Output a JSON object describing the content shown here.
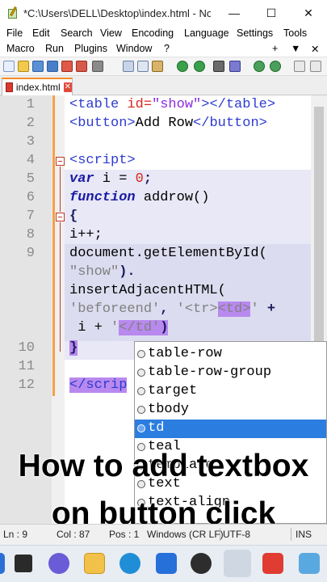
{
  "window": {
    "title": "*C:\\Users\\DELL\\Desktop\\index.html - Note...",
    "minimize_glyph": "—",
    "maximize_glyph": "☐",
    "close_glyph": "✕"
  },
  "menu": {
    "row1": [
      "File",
      "Edit",
      "Search",
      "View",
      "Encoding",
      "Language",
      "Settings",
      "Tools"
    ],
    "row2": [
      "Macro",
      "Run",
      "Plugins",
      "Window",
      "?"
    ],
    "right_controls": [
      "+",
      "▼",
      "✕"
    ]
  },
  "tab": {
    "name": "index.html",
    "close_glyph": "✕"
  },
  "editor": {
    "line_numbers": [
      "1",
      "2",
      "3",
      "4",
      "5",
      "6",
      "7",
      "8",
      "9",
      "10",
      "11",
      "12"
    ],
    "line1": {
      "open": "<table ",
      "attr": "id=",
      "value": "\"show\"",
      "close": "></table>"
    },
    "line2": {
      "open": "<button>",
      "text": "Add Row",
      "close": "</button>"
    },
    "line4": {
      "tag": "<script>"
    },
    "line5": {
      "kw": "var",
      "rest": " i = ",
      "num": "0",
      "end": ";"
    },
    "line6": {
      "kw": "function",
      "rest": " addrow()"
    },
    "line7": {
      "text": "{"
    },
    "line8": {
      "text": "i++;"
    },
    "line9a": {
      "text": "document.getElementById("
    },
    "line9b": {
      "str": "\"show\"",
      "end": ")."
    },
    "line9c": {
      "text": "insertAdjacentHTML("
    },
    "line9d": {
      "s1": "'beforeend'",
      "comma": ", ",
      "s2a": "'<tr>",
      "s2b": "<td>",
      "s2c": "'",
      "plus": " +"
    },
    "line9e": {
      "pre": " i + ",
      "q": "'",
      "s3": "</td",
      "q2": "'",
      "close": ")"
    },
    "line10": {
      "text": "}"
    },
    "line12": {
      "tag": "</scrip"
    }
  },
  "autocomplete": {
    "items": [
      "table-row",
      "table-row-group",
      "target",
      "tbody",
      "td",
      "teal",
      "template",
      "text",
      "text-align"
    ],
    "selected_index": 4
  },
  "caption": {
    "line1": "How to add textbox",
    "line2": "on button click"
  },
  "status": {
    "ln": "Ln : 9",
    "col": "Col : 87",
    "pos": "Pos : 1",
    "eol": "Windows (CR LF)",
    "encoding": "UTF-8",
    "mode": "INS"
  },
  "taskbar": {
    "apps": [
      "windows-start",
      "task-view",
      "teams-chat",
      "file-explorer",
      "edge-browser",
      "microsoft-store",
      "obs-studio",
      "notepad-plus-plus",
      "anydesk",
      "notepad"
    ]
  }
}
